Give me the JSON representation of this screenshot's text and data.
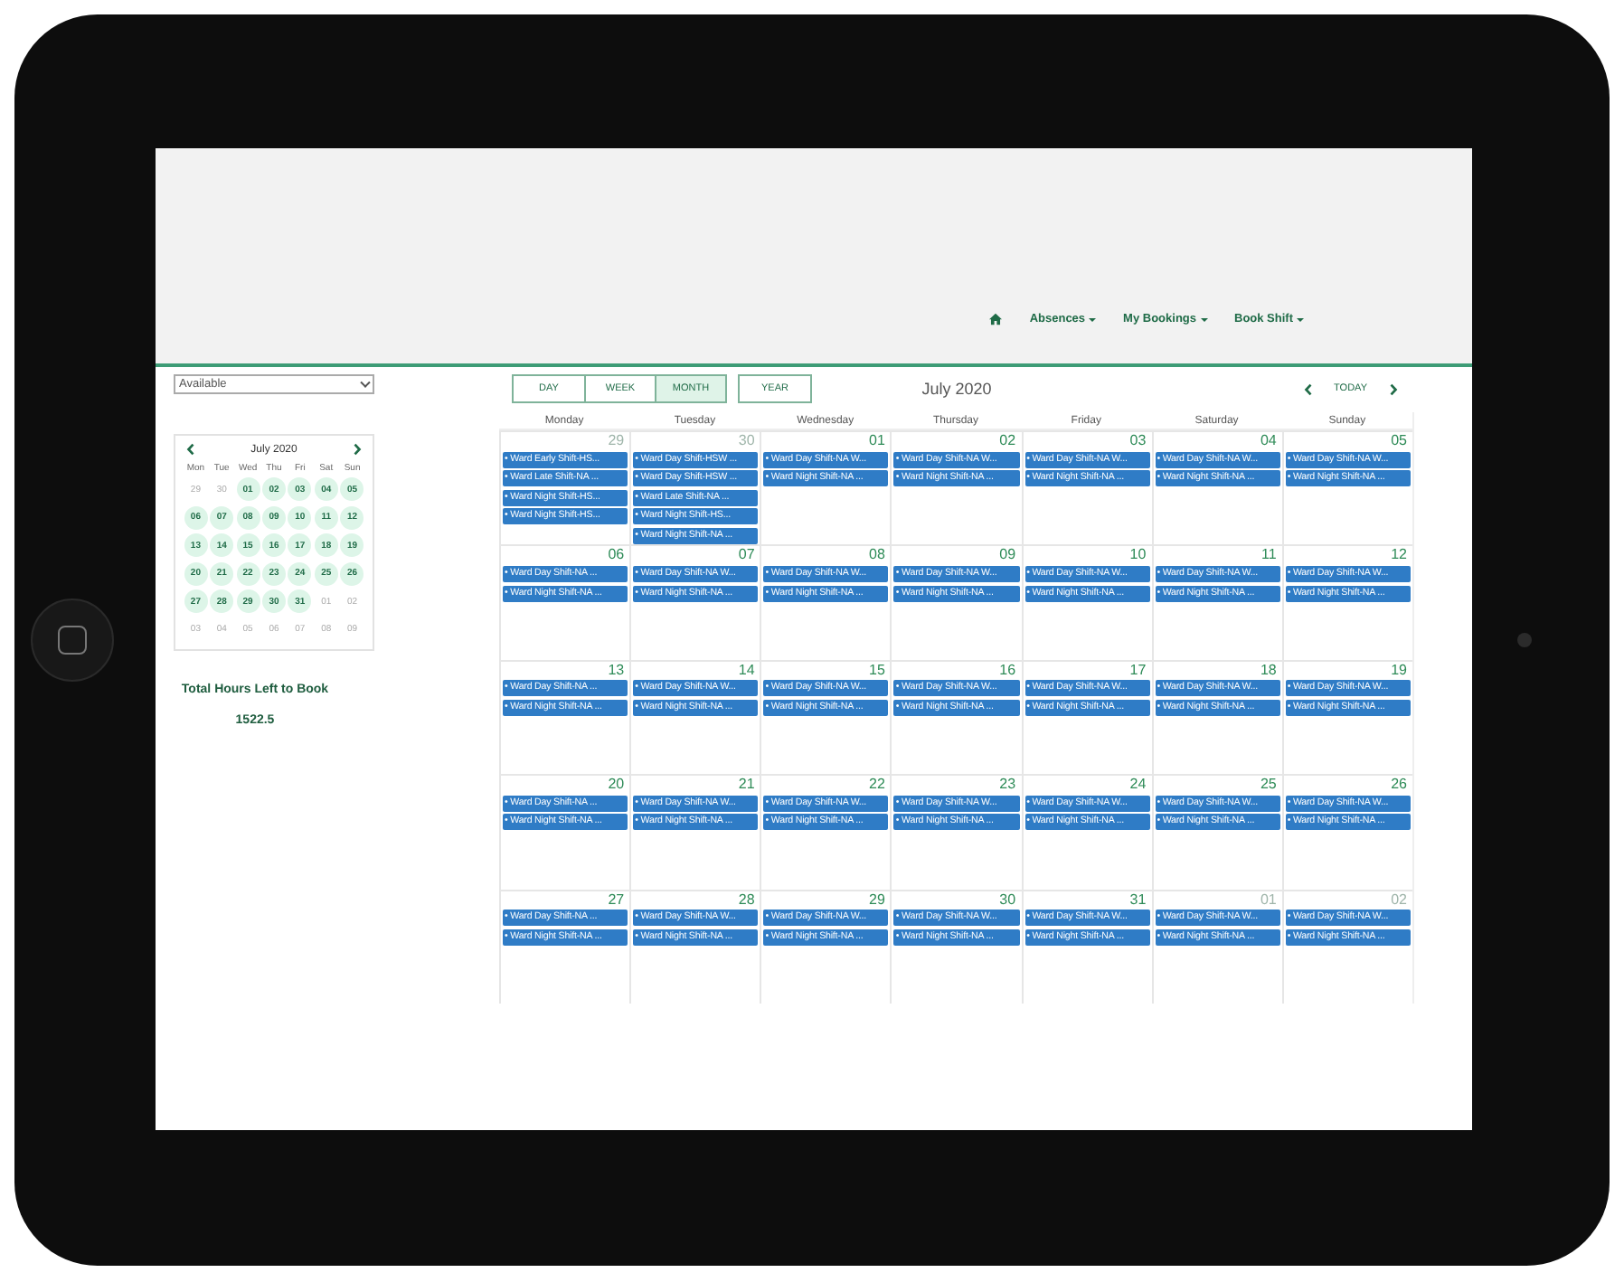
{
  "nav": {
    "items": [
      {
        "label": "Absences"
      },
      {
        "label": "My Bookings"
      },
      {
        "label": "Book Shift"
      }
    ]
  },
  "filter": {
    "value": "Available"
  },
  "mini_calendar": {
    "title": "July 2020",
    "weekdays": [
      "Mon",
      "Tue",
      "Wed",
      "Thu",
      "Fri",
      "Sat",
      "Sun"
    ],
    "weeks": [
      [
        {
          "label": "29",
          "in_month": false
        },
        {
          "label": "30",
          "in_month": false
        },
        {
          "label": "01",
          "in_month": true
        },
        {
          "label": "02",
          "in_month": true
        },
        {
          "label": "03",
          "in_month": true
        },
        {
          "label": "04",
          "in_month": true
        },
        {
          "label": "05",
          "in_month": true
        }
      ],
      [
        {
          "label": "06",
          "in_month": true
        },
        {
          "label": "07",
          "in_month": true
        },
        {
          "label": "08",
          "in_month": true
        },
        {
          "label": "09",
          "in_month": true
        },
        {
          "label": "10",
          "in_month": true
        },
        {
          "label": "11",
          "in_month": true
        },
        {
          "label": "12",
          "in_month": true
        }
      ],
      [
        {
          "label": "13",
          "in_month": true
        },
        {
          "label": "14",
          "in_month": true
        },
        {
          "label": "15",
          "in_month": true
        },
        {
          "label": "16",
          "in_month": true
        },
        {
          "label": "17",
          "in_month": true
        },
        {
          "label": "18",
          "in_month": true
        },
        {
          "label": "19",
          "in_month": true
        }
      ],
      [
        {
          "label": "20",
          "in_month": true
        },
        {
          "label": "21",
          "in_month": true
        },
        {
          "label": "22",
          "in_month": true
        },
        {
          "label": "23",
          "in_month": true
        },
        {
          "label": "24",
          "in_month": true
        },
        {
          "label": "25",
          "in_month": true
        },
        {
          "label": "26",
          "in_month": true
        }
      ],
      [
        {
          "label": "27",
          "in_month": true
        },
        {
          "label": "28",
          "in_month": true
        },
        {
          "label": "29",
          "in_month": true
        },
        {
          "label": "30",
          "in_month": true
        },
        {
          "label": "31",
          "in_month": true
        },
        {
          "label": "01",
          "in_month": false
        },
        {
          "label": "02",
          "in_month": false
        }
      ],
      [
        {
          "label": "03",
          "in_month": false
        },
        {
          "label": "04",
          "in_month": false
        },
        {
          "label": "05",
          "in_month": false
        },
        {
          "label": "06",
          "in_month": false
        },
        {
          "label": "07",
          "in_month": false
        },
        {
          "label": "08",
          "in_month": false
        },
        {
          "label": "09",
          "in_month": false
        }
      ]
    ]
  },
  "total": {
    "label": "Total Hours Left to Book",
    "value": "1522.5"
  },
  "view_buttons": [
    {
      "label": "DAY",
      "selected": false
    },
    {
      "label": "WEEK",
      "selected": false
    },
    {
      "label": "MONTH",
      "selected": true
    },
    {
      "label": "YEAR",
      "selected": false
    }
  ],
  "calendar": {
    "title": "July 2020",
    "today": "TODAY",
    "weekdays": [
      "Monday",
      "Tuesday",
      "Wednesday",
      "Thursday",
      "Friday",
      "Saturday",
      "Sunday"
    ],
    "weeks": [
      [
        {
          "date": "29",
          "in_month": false,
          "events": [
            "• Ward Early Shift-HS...",
            "• Ward Late Shift-NA ...",
            "• Ward Night Shift-HS...",
            "• Ward Night Shift-HS..."
          ]
        },
        {
          "date": "30",
          "in_month": false,
          "events": [
            "• Ward Day Shift-HSW ...",
            "• Ward Day Shift-HSW ...",
            "• Ward Late Shift-NA ...",
            "• Ward Night Shift-HS...",
            "• Ward Night Shift-NA ..."
          ]
        },
        {
          "date": "01",
          "in_month": true,
          "events": [
            "• Ward Day Shift-NA W...",
            "• Ward Night Shift-NA ..."
          ]
        },
        {
          "date": "02",
          "in_month": true,
          "events": [
            "• Ward Day Shift-NA W...",
            "• Ward Night Shift-NA ..."
          ]
        },
        {
          "date": "03",
          "in_month": true,
          "events": [
            "• Ward Day Shift-NA W...",
            "• Ward Night Shift-NA ..."
          ]
        },
        {
          "date": "04",
          "in_month": true,
          "events": [
            "• Ward Day Shift-NA W...",
            "• Ward Night Shift-NA ..."
          ]
        },
        {
          "date": "05",
          "in_month": true,
          "events": [
            "• Ward Day Shift-NA W...",
            "• Ward Night Shift-NA ..."
          ]
        }
      ],
      [
        {
          "date": "06",
          "in_month": true,
          "events": [
            "• Ward Day Shift-NA ...",
            "• Ward Night Shift-NA ..."
          ]
        },
        {
          "date": "07",
          "in_month": true,
          "events": [
            "• Ward Day Shift-NA W...",
            "• Ward Night Shift-NA ..."
          ]
        },
        {
          "date": "08",
          "in_month": true,
          "events": [
            "• Ward Day Shift-NA W...",
            "• Ward Night Shift-NA ..."
          ]
        },
        {
          "date": "09",
          "in_month": true,
          "events": [
            "• Ward Day Shift-NA W...",
            "• Ward Night Shift-NA ..."
          ]
        },
        {
          "date": "10",
          "in_month": true,
          "events": [
            "• Ward Day Shift-NA W...",
            "• Ward Night Shift-NA ..."
          ]
        },
        {
          "date": "11",
          "in_month": true,
          "events": [
            "• Ward Day Shift-NA W...",
            "• Ward Night Shift-NA ..."
          ]
        },
        {
          "date": "12",
          "in_month": true,
          "events": [
            "• Ward Day Shift-NA W...",
            "• Ward Night Shift-NA ..."
          ]
        }
      ],
      [
        {
          "date": "13",
          "in_month": true,
          "events": [
            "• Ward Day Shift-NA ...",
            "• Ward Night Shift-NA ..."
          ]
        },
        {
          "date": "14",
          "in_month": true,
          "events": [
            "• Ward Day Shift-NA W...",
            "• Ward Night Shift-NA ..."
          ]
        },
        {
          "date": "15",
          "in_month": true,
          "events": [
            "• Ward Day Shift-NA W...",
            "• Ward Night Shift-NA ..."
          ]
        },
        {
          "date": "16",
          "in_month": true,
          "events": [
            "• Ward Day Shift-NA W...",
            "• Ward Night Shift-NA ..."
          ]
        },
        {
          "date": "17",
          "in_month": true,
          "events": [
            "• Ward Day Shift-NA W...",
            "• Ward Night Shift-NA ..."
          ]
        },
        {
          "date": "18",
          "in_month": true,
          "events": [
            "• Ward Day Shift-NA W...",
            "• Ward Night Shift-NA ..."
          ]
        },
        {
          "date": "19",
          "in_month": true,
          "events": [
            "• Ward Day Shift-NA W...",
            "• Ward Night Shift-NA ..."
          ]
        }
      ],
      [
        {
          "date": "20",
          "in_month": true,
          "events": [
            "• Ward Day Shift-NA ...",
            "• Ward Night Shift-NA ..."
          ]
        },
        {
          "date": "21",
          "in_month": true,
          "events": [
            "• Ward Day Shift-NA W...",
            "• Ward Night Shift-NA ..."
          ]
        },
        {
          "date": "22",
          "in_month": true,
          "events": [
            "• Ward Day Shift-NA W...",
            "• Ward Night Shift-NA ..."
          ]
        },
        {
          "date": "23",
          "in_month": true,
          "events": [
            "• Ward Day Shift-NA W...",
            "• Ward Night Shift-NA ..."
          ]
        },
        {
          "date": "24",
          "in_month": true,
          "events": [
            "• Ward Day Shift-NA W...",
            "• Ward Night Shift-NA ..."
          ]
        },
        {
          "date": "25",
          "in_month": true,
          "events": [
            "• Ward Day Shift-NA W...",
            "• Ward Night Shift-NA ..."
          ]
        },
        {
          "date": "26",
          "in_month": true,
          "events": [
            "• Ward Day Shift-NA W...",
            "• Ward Night Shift-NA ..."
          ]
        }
      ],
      [
        {
          "date": "27",
          "in_month": true,
          "events": [
            "• Ward Day Shift-NA ...",
            "• Ward Night Shift-NA ..."
          ]
        },
        {
          "date": "28",
          "in_month": true,
          "events": [
            "• Ward Day Shift-NA W...",
            "• Ward Night Shift-NA ..."
          ]
        },
        {
          "date": "29",
          "in_month": true,
          "events": [
            "• Ward Day Shift-NA W...",
            "• Ward Night Shift-NA ..."
          ]
        },
        {
          "date": "30",
          "in_month": true,
          "events": [
            "• Ward Day Shift-NA W...",
            "• Ward Night Shift-NA ..."
          ]
        },
        {
          "date": "31",
          "in_month": true,
          "events": [
            "• Ward Day Shift-NA W...",
            "• Ward Night Shift-NA ..."
          ]
        },
        {
          "date": "01",
          "in_month": false,
          "events": [
            "• Ward Day Shift-NA W...",
            "• Ward Night Shift-NA ..."
          ]
        },
        {
          "date": "02",
          "in_month": false,
          "events": [
            "• Ward Day Shift-NA W...",
            "• Ward Night Shift-NA ..."
          ]
        }
      ]
    ]
  }
}
